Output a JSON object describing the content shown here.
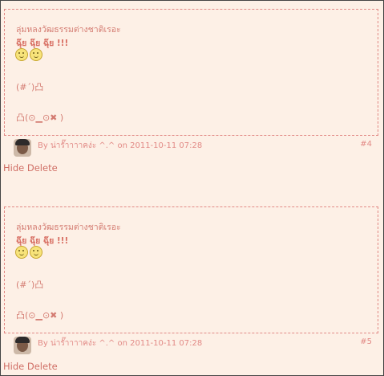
{
  "posts": [
    {
      "subject": "ลุ่มหลงวัฒธรรมต่างชาติเรอะ",
      "bold_line": "ฉุ๊ย ฉุ๊ย ฉุ๊ย !!!",
      "emoticon_line_1": "(#´)凸",
      "emoticon_line_2": "凸(⊙▁⊙✖ )",
      "byline": "By น่ารั๊าาาาคง่ะ ^.^ on 2011-10-11 07:28",
      "post_number": "#4",
      "hide_label": "Hide",
      "delete_label": "Delete"
    },
    {
      "subject": "ลุ่มหลงวัฒธรรมต่างชาติเรอะ",
      "bold_line": "ฉุ๊ย ฉุ๊ย ฉุ๊ย !!!",
      "emoticon_line_1": "(#´)凸",
      "emoticon_line_2": "凸(⊙▁⊙✖ )",
      "byline": "By น่ารั๊าาาาคง่ะ ^.^ on 2011-10-11 07:28",
      "post_number": "#5",
      "hide_label": "Hide",
      "delete_label": "Delete"
    }
  ],
  "icons": {
    "smiley": "smiley-icon",
    "avatar": "avatar"
  },
  "colors": {
    "background": "#fdf0e6",
    "accent": "#e28a86",
    "text": "#d47c72"
  }
}
